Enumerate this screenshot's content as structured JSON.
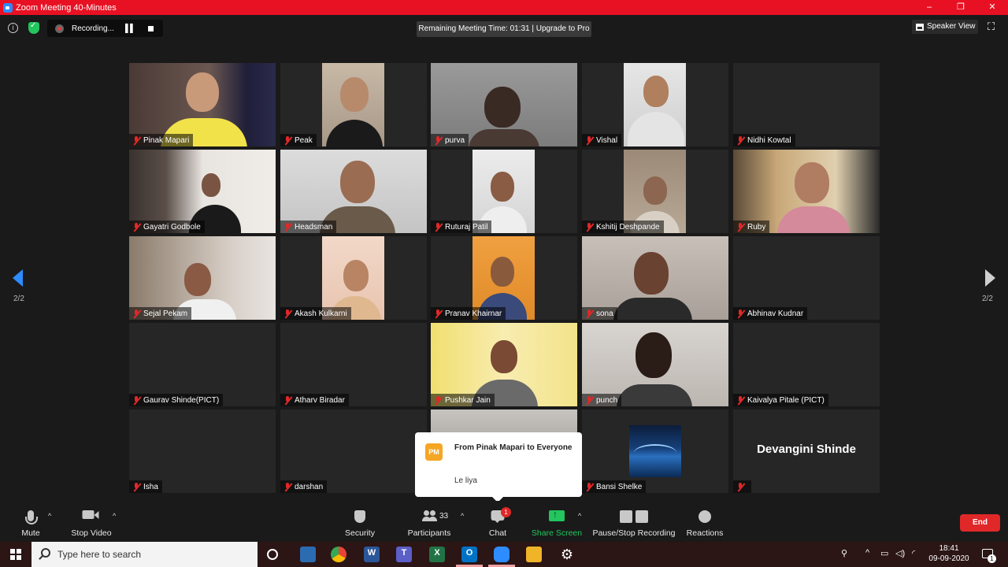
{
  "window": {
    "title": "Zoom Meeting 40-Minutes",
    "minimize": "–",
    "maximize": "❐",
    "close": "✕"
  },
  "topbar": {
    "recording_label": "Recording...",
    "remaining_time": "Remaining Meeting Time: 01:31 | Upgrade to Pro",
    "speaker_view_label": "Speaker View"
  },
  "grid": {
    "page_indicator_left": "2/2",
    "page_indicator_right": "2/2",
    "participants": [
      {
        "name": "Pinak Mapari",
        "video": true
      },
      {
        "name": "Peak",
        "video": true
      },
      {
        "name": "purva",
        "video": true
      },
      {
        "name": "Vishal",
        "video": true
      },
      {
        "name": "Nidhi Kowtal",
        "video": false
      },
      {
        "name": "Gayatri Godbole",
        "video": true
      },
      {
        "name": "Headsman",
        "video": true
      },
      {
        "name": "Ruturaj Patil",
        "video": true
      },
      {
        "name": "Kshitij Deshpande",
        "video": true
      },
      {
        "name": "Ruby",
        "video": true
      },
      {
        "name": "Sejal Pekam",
        "video": true
      },
      {
        "name": "Akash Kulkarni",
        "video": true
      },
      {
        "name": "Pranav Khairnar",
        "video": true
      },
      {
        "name": "sona",
        "video": true
      },
      {
        "name": "Abhinav Kudnar",
        "video": false
      },
      {
        "name": "Gaurav Shinde(PICT)",
        "video": false
      },
      {
        "name": "Atharv Biradar",
        "video": false
      },
      {
        "name": "Pushkar Jain",
        "video": true
      },
      {
        "name": "punch",
        "video": true
      },
      {
        "name": "Kaivalya Pitale (PICT)",
        "video": false
      },
      {
        "name": "Isha",
        "video": false
      },
      {
        "name": "darshan",
        "video": false
      },
      {
        "name": "",
        "video": true
      },
      {
        "name": "Bansi Shelke",
        "video": false
      },
      {
        "name": "",
        "video": false,
        "big_name": "Devangini Shinde"
      }
    ]
  },
  "chat_popup": {
    "avatar_initials": "PM",
    "from": "From Pinak Mapari to Everyone",
    "message": "Le liya"
  },
  "toolbar": {
    "mute": "Mute",
    "stop_video": "Stop Video",
    "security": "Security",
    "participants": "Participants",
    "participants_count": "33",
    "chat": "Chat",
    "chat_badge": "1",
    "share_screen": "Share Screen",
    "pause_stop_recording": "Pause/Stop Recording",
    "reactions": "Reactions",
    "end": "End"
  },
  "taskbar": {
    "search_placeholder": "Type here to search",
    "time": "18:41",
    "date": "09-09-2020",
    "notification_count": "1"
  },
  "colors": {
    "titlebar": "#e81123",
    "accent_blue": "#2d8cff",
    "share_green": "#22c55e",
    "end_red": "#e02828"
  }
}
